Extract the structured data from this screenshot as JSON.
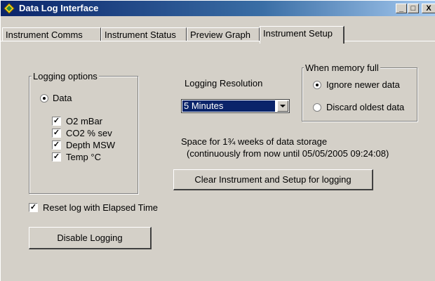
{
  "window": {
    "title": "Data Log Interface",
    "controls": {
      "minimize": "_",
      "maximize": "□",
      "close": "X"
    }
  },
  "tabs": [
    {
      "label": "Instrument Comms",
      "active": false
    },
    {
      "label": "Instrument Status",
      "active": false
    },
    {
      "label": "Preview Graph",
      "active": false
    },
    {
      "label": "Instrument Setup",
      "active": true
    }
  ],
  "logging_options": {
    "title": "Logging options",
    "data_radio": {
      "label": "Data",
      "selected": true
    },
    "checkboxes": [
      {
        "label": "O2 mBar",
        "checked": true
      },
      {
        "label": "CO2 % sev",
        "checked": true
      },
      {
        "label": "Depth MSW",
        "checked": true
      },
      {
        "label": "Temp °C",
        "checked": true
      }
    ]
  },
  "logging_resolution": {
    "label": "Logging Resolution",
    "selected": "5 Minutes"
  },
  "memory_full": {
    "title": "When memory full",
    "options": [
      {
        "label": "Ignore newer data",
        "selected": true
      },
      {
        "label": "Discard oldest data",
        "selected": false
      }
    ]
  },
  "storage": {
    "line1": "Space for 1¾ weeks of data storage",
    "line2": "(continuously from now until 05/05/2005 09:24:08)"
  },
  "buttons": {
    "clear_setup": "Clear Instrument and Setup for logging",
    "disable_logging": "Disable Logging"
  },
  "reset_log": {
    "label": "Reset log with Elapsed Time",
    "checked": true
  },
  "colors": {
    "titlebar": "#0a246a",
    "selection": "#0a246a",
    "face": "#d4d0c8"
  }
}
